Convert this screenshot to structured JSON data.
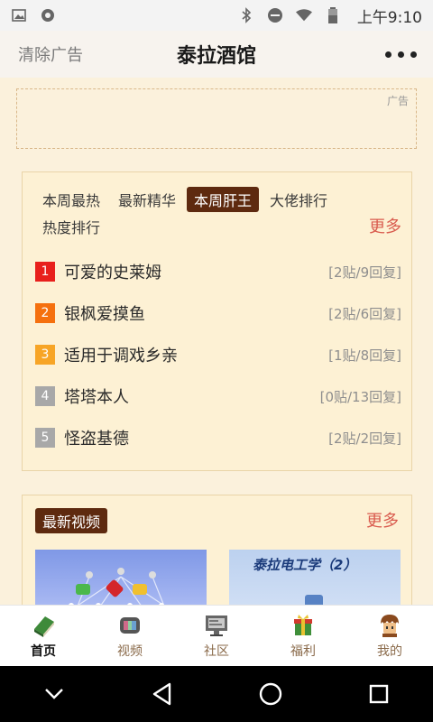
{
  "status_bar": {
    "time": "上午9:10"
  },
  "header": {
    "left_action": "清除广告",
    "title": "泰拉酒馆"
  },
  "ad": {
    "label": "广告"
  },
  "ranking": {
    "tabs": [
      {
        "label": "本周最热",
        "active": false
      },
      {
        "label": "最新精华",
        "active": false
      },
      {
        "label": "本周肝王",
        "active": true
      },
      {
        "label": "大佬排行",
        "active": false
      },
      {
        "label": "热度排行",
        "active": false
      }
    ],
    "more": "更多",
    "items": [
      {
        "rank": "1",
        "title": "可爱的史莱姆",
        "stats": "[2贴/9回复]",
        "color": "#e8201c"
      },
      {
        "rank": "2",
        "title": "银枫爱摸鱼",
        "stats": "[2贴/6回复]",
        "color": "#f5700e"
      },
      {
        "rank": "3",
        "title": "适用于调戏乡亲",
        "stats": "[1贴/8回复]",
        "color": "#f7a526"
      },
      {
        "rank": "4",
        "title": "塔塔本人",
        "stats": "[0贴/13回复]",
        "color": "#a8a8a8"
      },
      {
        "rank": "5",
        "title": "怪盗基德",
        "stats": "[2贴/2回复]",
        "color": "#a8a8a8"
      }
    ]
  },
  "videos": {
    "title": "最新视频",
    "more": "更多",
    "thumbs": [
      {
        "caption": ""
      },
      {
        "caption": "泰拉电工学（2）"
      }
    ]
  },
  "bottom_nav": {
    "items": [
      {
        "label": "首页",
        "icon": "book-icon",
        "active": true
      },
      {
        "label": "视频",
        "icon": "tv-icon",
        "active": false
      },
      {
        "label": "社区",
        "icon": "monitor-icon",
        "active": false
      },
      {
        "label": "福利",
        "icon": "gift-icon",
        "active": false
      },
      {
        "label": "我的",
        "icon": "avatar-icon",
        "active": false
      }
    ]
  },
  "colors": {
    "accent": "#5e2a0f",
    "more": "#d95b4e",
    "background": "#fbf1dc"
  }
}
